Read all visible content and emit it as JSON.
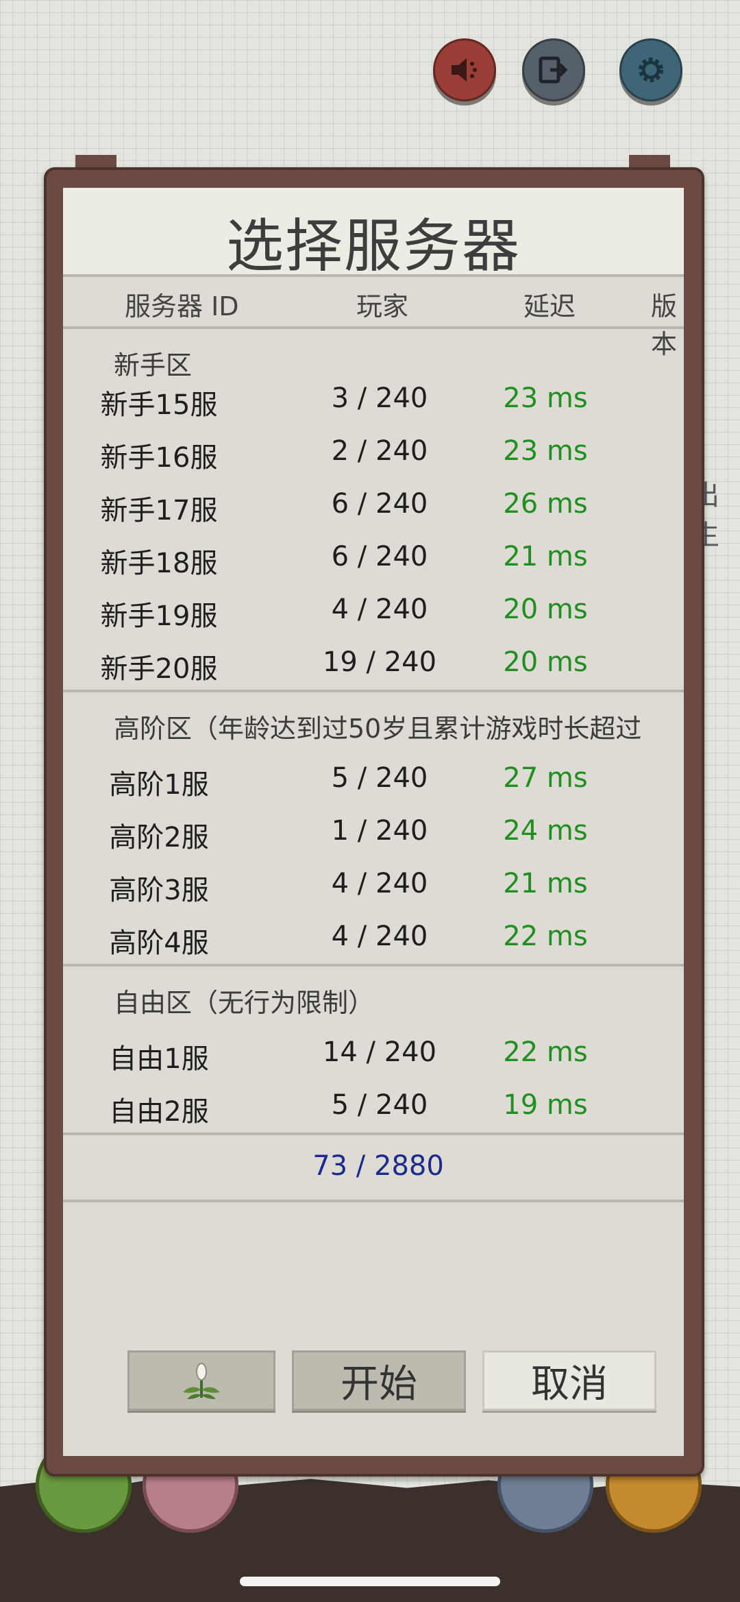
{
  "top_buttons": [
    {
      "icon": "speaker-icon",
      "color": "#9a3d36"
    },
    {
      "icon": "exit-icon",
      "color": "#55606a"
    },
    {
      "icon": "gear-icon",
      "color": "#3f6677"
    }
  ],
  "background_text": "出生",
  "dialog": {
    "title": "选择服务器",
    "columns": [
      "服务器 ID",
      "玩家",
      "延迟",
      "版本"
    ],
    "sections": [
      {
        "title": "新手区",
        "servers": [
          {
            "name": "新手15服",
            "players": "3 / 240",
            "ping": "23 ms"
          },
          {
            "name": "新手16服",
            "players": "2 / 240",
            "ping": "23 ms"
          },
          {
            "name": "新手17服",
            "players": "6 / 240",
            "ping": "26 ms"
          },
          {
            "name": "新手18服",
            "players": "6 / 240",
            "ping": "21 ms"
          },
          {
            "name": "新手19服",
            "players": "4 / 240",
            "ping": "20 ms"
          },
          {
            "name": "新手20服",
            "players": "19 / 240",
            "ping": "20 ms"
          }
        ]
      },
      {
        "title": "高阶区（年龄达到过50岁且累计游戏时长超过",
        "servers": [
          {
            "name": "高阶1服",
            "players": "5 / 240",
            "ping": "27 ms"
          },
          {
            "name": "高阶2服",
            "players": "1 / 240",
            "ping": "24 ms"
          },
          {
            "name": "高阶3服",
            "players": "4 / 240",
            "ping": "21 ms"
          },
          {
            "name": "高阶4服",
            "players": "4 / 240",
            "ping": "22 ms"
          }
        ]
      },
      {
        "title": "自由区（无行为限制）",
        "servers": [
          {
            "name": "自由1服",
            "players": "14 / 240",
            "ping": "22 ms"
          },
          {
            "name": "自由2服",
            "players": "5 / 240",
            "ping": "19 ms"
          }
        ]
      }
    ],
    "total": "73 / 2880",
    "buttons": {
      "plant_icon": "plant-icon",
      "start": "开始",
      "cancel": "取消"
    }
  },
  "colors": {
    "ping": "#1f8f1f",
    "total": "#1a2a8f",
    "frame": "#6b4a42"
  }
}
